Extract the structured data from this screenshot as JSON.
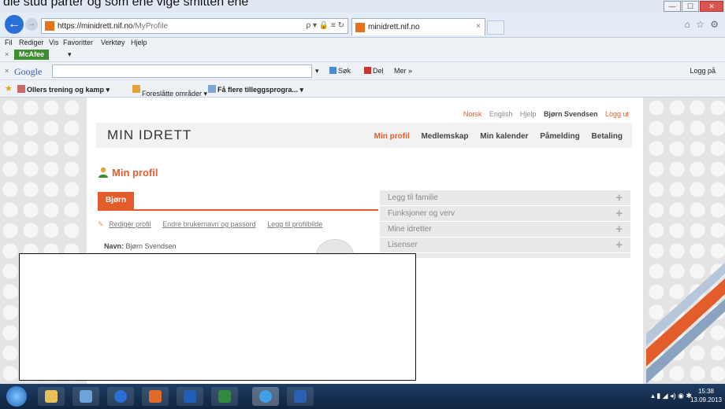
{
  "caption": "dle stud parter og som ehe vige smitten ene",
  "browser": {
    "url_host": "https://minidrett.nif.no",
    "url_path": "/MyProfile",
    "address_icons": "ρ ▾ 🔒 ≡ ↻",
    "tab_title": "minidrett.nif.no",
    "tab_close": "×",
    "window_buttons": [
      "—",
      "☐",
      "✕"
    ],
    "right_icons": "⌂ ☆ ⚙"
  },
  "menu": [
    "Fil",
    "Rediger",
    "Vis",
    "Favoritter",
    "Verktøy",
    "Hjelp"
  ],
  "mcafee": {
    "close": "×",
    "label": "McAfee",
    "caret": "▾"
  },
  "google": {
    "close": "×",
    "label": "Google",
    "caret": "▾",
    "search": "Søk",
    "share": "Del",
    "more": "Mer »",
    "login": "Logg på"
  },
  "favorites": {
    "ollers": "Ollers trening og kamp ▾",
    "suggested": "Foreslåtte områder ▾",
    "addons": "Få flere tilleggsprogra... ▾"
  },
  "site": {
    "top_links": {
      "lang1": "Norsk",
      "lang2": "English",
      "help": "Hjelp",
      "user": "Bjørn Svendsen",
      "logout": "Logg ut"
    },
    "logo": "MIN IDRETT",
    "nav": [
      "Min profil",
      "Medlemskap",
      "Min kalender",
      "Påmelding",
      "Betaling"
    ],
    "page_title": "Min profil",
    "person_tab": "Bjørn",
    "profile_links": [
      "Redigér profil",
      "Endre brukernavn og passord",
      "Legg til profilbilde"
    ],
    "name_label": "Navn:",
    "name_value": "Bjørn Svendsen",
    "side_items": [
      "Legg til familie",
      "Funksjoner og verv",
      "Mine idretter",
      "Lisenser"
    ],
    "plus": "+"
  },
  "taskbar": {
    "tray": "▴  ▮  ◢  ◂)  ◉  ✱",
    "time": "15:38",
    "date": "13.09.2013"
  },
  "colors": {
    "accent": "#e35d2a",
    "taskbar": "#1e3d63",
    "mcafee": "#3f8e2f"
  }
}
